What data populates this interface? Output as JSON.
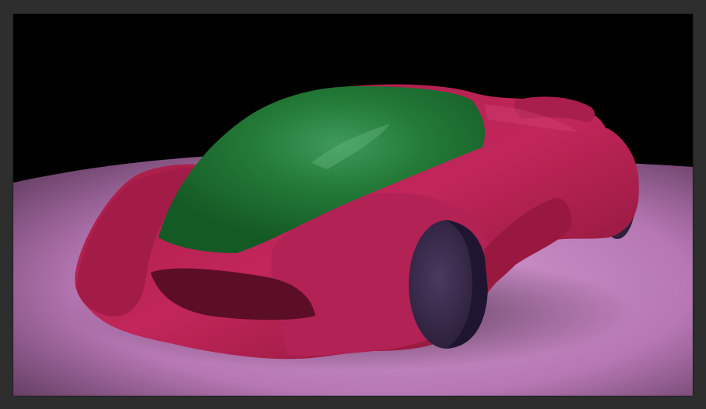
{
  "viewport": {
    "content": "render-output",
    "subject": "concept-car",
    "colors": {
      "frame": "#2d2d2d",
      "background": "#000000",
      "floor": "#c88ac5",
      "body": "#b8204f",
      "canopy": "#1c6b30",
      "tires": "#3a2b4d"
    }
  }
}
